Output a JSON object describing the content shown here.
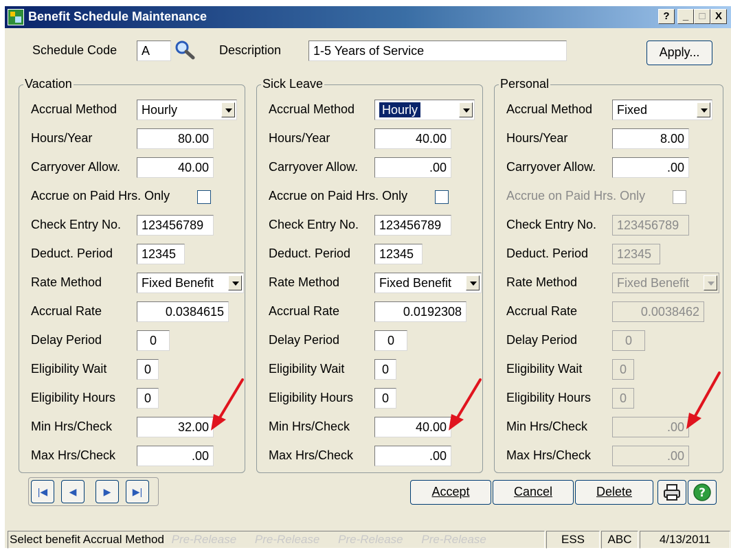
{
  "window": {
    "title": "Benefit Schedule Maintenance",
    "help_btn": "?",
    "min_btn": "_",
    "max_btn": "□",
    "close_btn": "X"
  },
  "header": {
    "schedule_code_label": "Schedule Code",
    "schedule_code_value": "A",
    "description_label": "Description",
    "description_value": "1-5 Years of Service",
    "apply_label": "Apply..."
  },
  "labels": {
    "accrual_method": "Accrual Method",
    "hours_year": "Hours/Year",
    "carryover": "Carryover Allow.",
    "accrue_paid": "Accrue on Paid Hrs. Only",
    "check_entry": "Check Entry No.",
    "deduct_period": "Deduct. Period",
    "rate_method": "Rate Method",
    "accrual_rate": "Accrual Rate",
    "delay_period": "Delay Period",
    "elig_wait": "Eligibility Wait",
    "elig_hours": "Eligibility Hours",
    "min_hrs": "Min Hrs/Check",
    "max_hrs": "Max Hrs/Check"
  },
  "groups": [
    {
      "title": "Vacation",
      "accrual_method": "Hourly",
      "hours_year": "80.00",
      "carryover": "40.00",
      "accrue_paid_checked": false,
      "check_entry": "123456789",
      "deduct_period": "12345",
      "rate_method": "Fixed Benefit",
      "accrual_rate": "0.0384615",
      "delay_period": "0",
      "elig_wait": "0",
      "elig_hours": "0",
      "min_hrs": "32.00",
      "max_hrs": ".00"
    },
    {
      "title": "Sick Leave",
      "accrual_method": "Hourly",
      "hours_year": "40.00",
      "carryover": ".00",
      "accrue_paid_checked": false,
      "check_entry": "123456789",
      "deduct_period": "12345",
      "rate_method": "Fixed Benefit",
      "accrual_rate": "0.0192308",
      "delay_period": "0",
      "elig_wait": "0",
      "elig_hours": "0",
      "min_hrs": "40.00",
      "max_hrs": ".00"
    },
    {
      "title": "Personal",
      "accrual_method": "Fixed",
      "hours_year": "8.00",
      "carryover": ".00",
      "accrue_paid_checked": false,
      "check_entry": "123456789",
      "deduct_period": "12345",
      "rate_method": "Fixed Benefit",
      "accrual_rate": "0.0038462",
      "delay_period": "0",
      "elig_wait": "0",
      "elig_hours": "0",
      "min_hrs": ".00",
      "max_hrs": ".00"
    }
  ],
  "nav": {
    "first": "|◀",
    "prev": "◀",
    "next": "▶",
    "last": "▶|"
  },
  "buttons": {
    "accept": "Accept",
    "cancel": "Cancel",
    "delete": "Delete"
  },
  "status": {
    "message": "Select benefit Accrual Method",
    "watermark": "Pre-Release",
    "module": "ESS",
    "company": "ABC",
    "date": "4/13/2011"
  },
  "colors": {
    "accent_red_arrow": "#e0141e",
    "title_bar": "#0a246a",
    "selection": "#0a246a"
  }
}
